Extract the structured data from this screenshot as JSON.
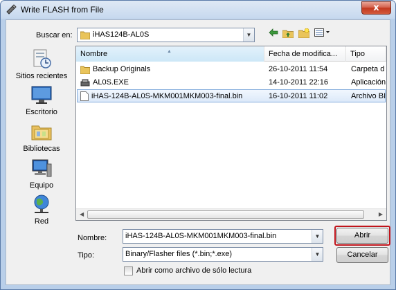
{
  "window": {
    "title": "Write FLASH from File",
    "close_glyph": "x"
  },
  "lookin": {
    "label": "Buscar en:",
    "value": "iHAS124B-AL0S"
  },
  "toolbar": [
    "back-icon",
    "up-folder-icon",
    "new-folder-icon",
    "view-menu-icon"
  ],
  "places": [
    {
      "label": "Sitios recientes",
      "icon": "recent-places-icon"
    },
    {
      "label": "Escritorio",
      "icon": "desktop-icon"
    },
    {
      "label": "Bibliotecas",
      "icon": "libraries-icon"
    },
    {
      "label": "Equipo",
      "icon": "computer-icon"
    },
    {
      "label": "Red",
      "icon": "network-icon"
    }
  ],
  "list": {
    "columns": [
      "Nombre",
      "Fecha de modifica...",
      "Tipo"
    ],
    "rows": [
      {
        "name": "Backup Originals",
        "date": "26-10-2011 11:54",
        "type": "Carpeta d",
        "icon": "folder-icon"
      },
      {
        "name": "AL0S.EXE",
        "date": "14-10-2011 22:16",
        "type": "Aplicación",
        "icon": "exe-icon"
      },
      {
        "name": "iHAS-124B-AL0S-MKM001MKM003-final.bin",
        "date": "16-10-2011 11:02",
        "type": "Archivo BI",
        "icon": "file-icon",
        "selected": true
      }
    ]
  },
  "filename": {
    "label": "Nombre:",
    "value": "iHAS-124B-AL0S-MKM001MKM003-final.bin"
  },
  "filetype": {
    "label": "Tipo:",
    "value": "Binary/Flasher files (*.bin;*.exe)"
  },
  "readonly": {
    "label": "Abrir como archivo de sólo lectura",
    "checked": false
  },
  "buttons": {
    "open": "Abrir",
    "cancel": "Cancelar"
  },
  "colors": {
    "title_gradient": "#c6d8ee",
    "selection": "#dce9f9",
    "highlight": "#c0141b",
    "close": "#c2381f"
  }
}
